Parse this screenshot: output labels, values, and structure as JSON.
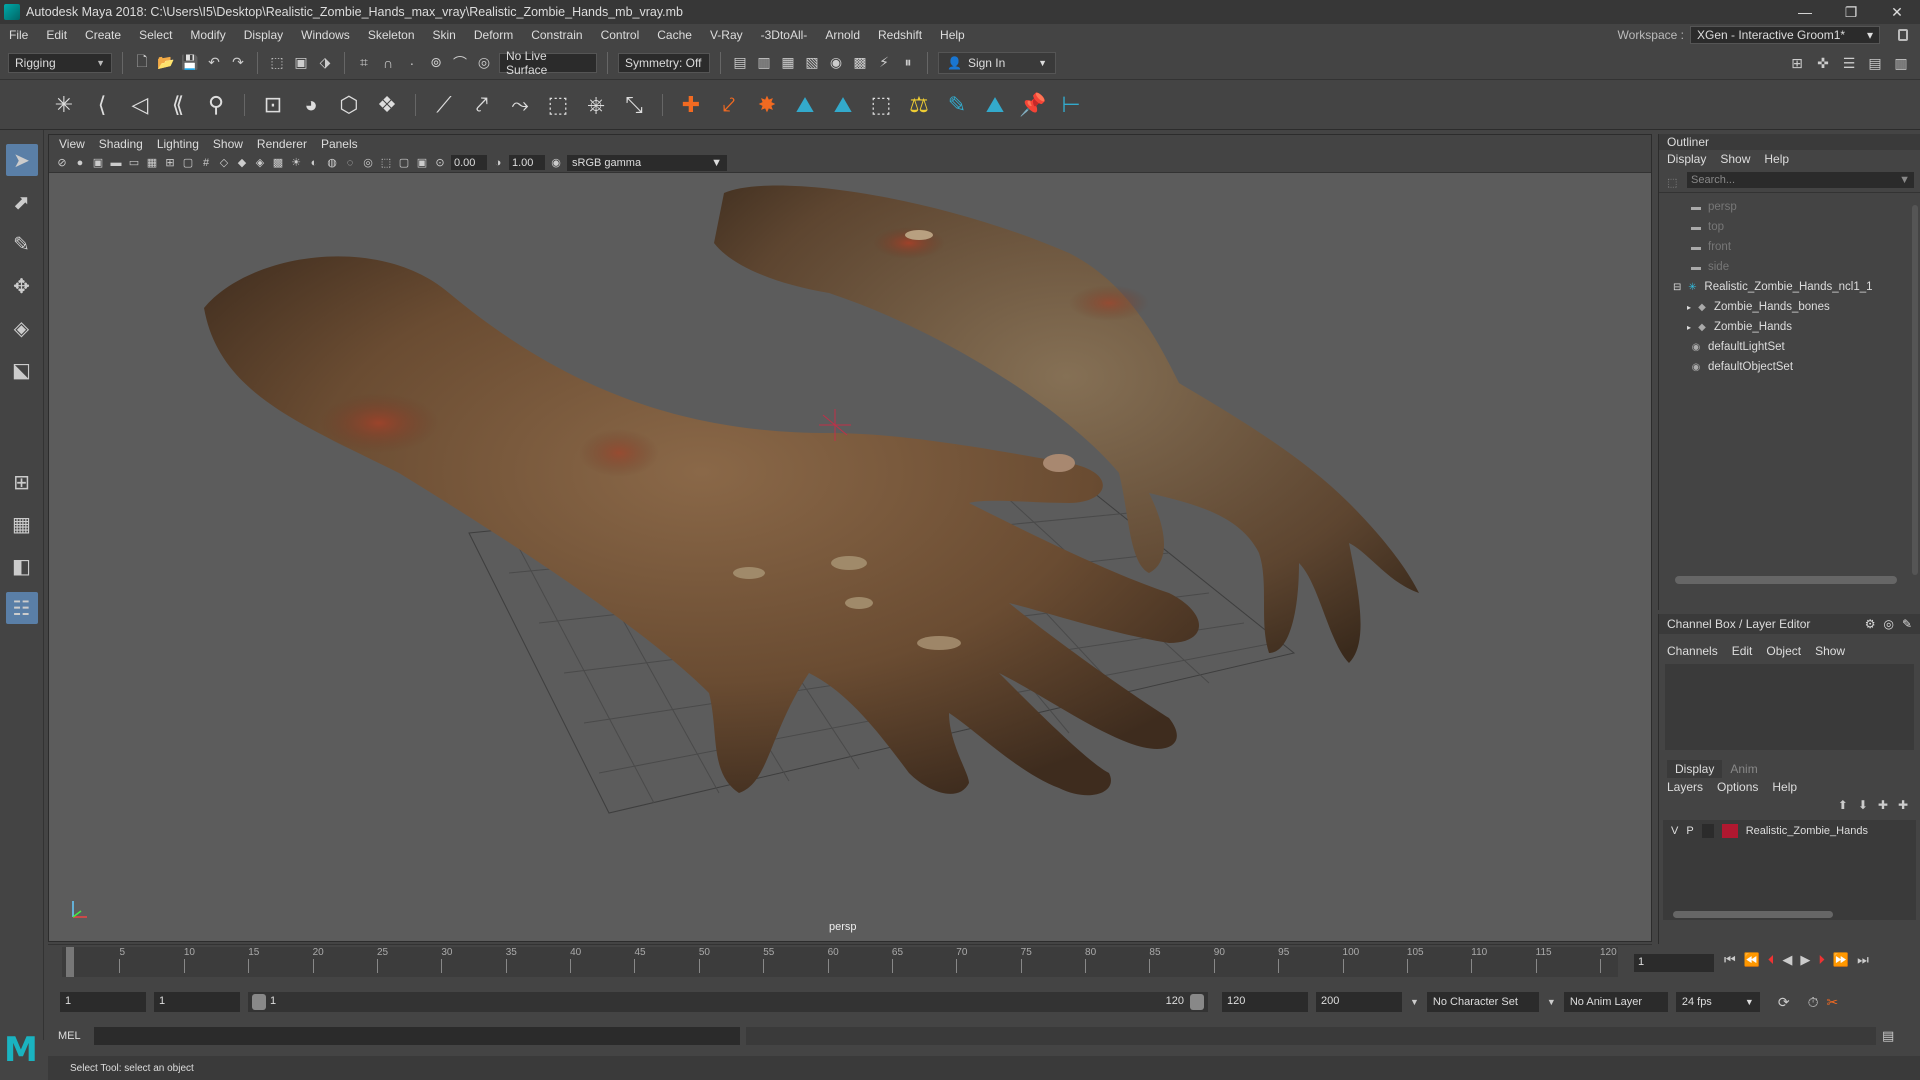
{
  "window": {
    "title": "Autodesk Maya 2018: C:\\Users\\I5\\Desktop\\Realistic_Zombie_Hands_max_vray\\Realistic_Zombie_Hands_mb_vray.mb",
    "minimize": "—",
    "maximize": "❐",
    "close": "✕"
  },
  "menubar": {
    "items": [
      "File",
      "Edit",
      "Create",
      "Select",
      "Modify",
      "Display",
      "Windows",
      "Skeleton",
      "Skin",
      "Deform",
      "Constrain",
      "Control",
      "Cache",
      "V-Ray",
      "-3DtoAll-",
      "Arnold",
      "Redshift",
      "Help"
    ]
  },
  "workspace": {
    "label": "Workspace :",
    "value": "XGen - Interactive Groom1*"
  },
  "statusline": {
    "menuset": "Rigging",
    "live_surface": "No Live Surface",
    "symmetry": "Symmetry: Off",
    "sign_in": "Sign In"
  },
  "viewport": {
    "menus": [
      "View",
      "Shading",
      "Lighting",
      "Show",
      "Renderer",
      "Panels"
    ],
    "exposure": "0.00",
    "gamma": "1.00",
    "color_space": "sRGB gamma",
    "camera": "persp"
  },
  "outliner": {
    "title": "Outliner",
    "menus": [
      "Display",
      "Show",
      "Help"
    ],
    "search_placeholder": "Search...",
    "items": [
      {
        "label": "persp",
        "dim": true
      },
      {
        "label": "top",
        "dim": true
      },
      {
        "label": "front",
        "dim": true
      },
      {
        "label": "side",
        "dim": true
      },
      {
        "label": "Realistic_Zombie_Hands_ncl1_1",
        "dim": false
      },
      {
        "label": "Zombie_Hands_bones",
        "dim": false
      },
      {
        "label": "Zombie_Hands",
        "dim": false
      },
      {
        "label": "defaultLightSet",
        "dim": false
      },
      {
        "label": "defaultObjectSet",
        "dim": false
      }
    ]
  },
  "channelbox": {
    "title": "Channel Box / Layer Editor",
    "menus": [
      "Channels",
      "Edit",
      "Object",
      "Show"
    ],
    "tabs": [
      "Display",
      "Anim"
    ],
    "layer_menus": [
      "Layers",
      "Options",
      "Help"
    ],
    "layer": {
      "v": "V",
      "p": "P",
      "name": "Realistic_Zombie_Hands",
      "color": "#b01830"
    }
  },
  "timeslider": {
    "ticks": [
      "1",
      "5",
      "10",
      "15",
      "20",
      "25",
      "30",
      "35",
      "40",
      "45",
      "50",
      "55",
      "60",
      "65",
      "70",
      "75",
      "80",
      "85",
      "90",
      "95",
      "100",
      "105",
      "110",
      "115",
      "120"
    ],
    "current_frame": "1"
  },
  "rangeslider": {
    "start": "1",
    "playback_start": "1",
    "range_start_label": "1",
    "range_end_label": "120",
    "playback_end": "120",
    "end": "200",
    "character_set": "No Character Set",
    "anim_layer": "No Anim Layer",
    "fps": "24 fps"
  },
  "cmdline": {
    "label": "MEL"
  },
  "helpline": {
    "text": "Select Tool: select an object"
  },
  "colors": {
    "accent": "#5a7fa7",
    "maya_logo": "#1ab3c0",
    "skin": "#7a5a3c"
  }
}
